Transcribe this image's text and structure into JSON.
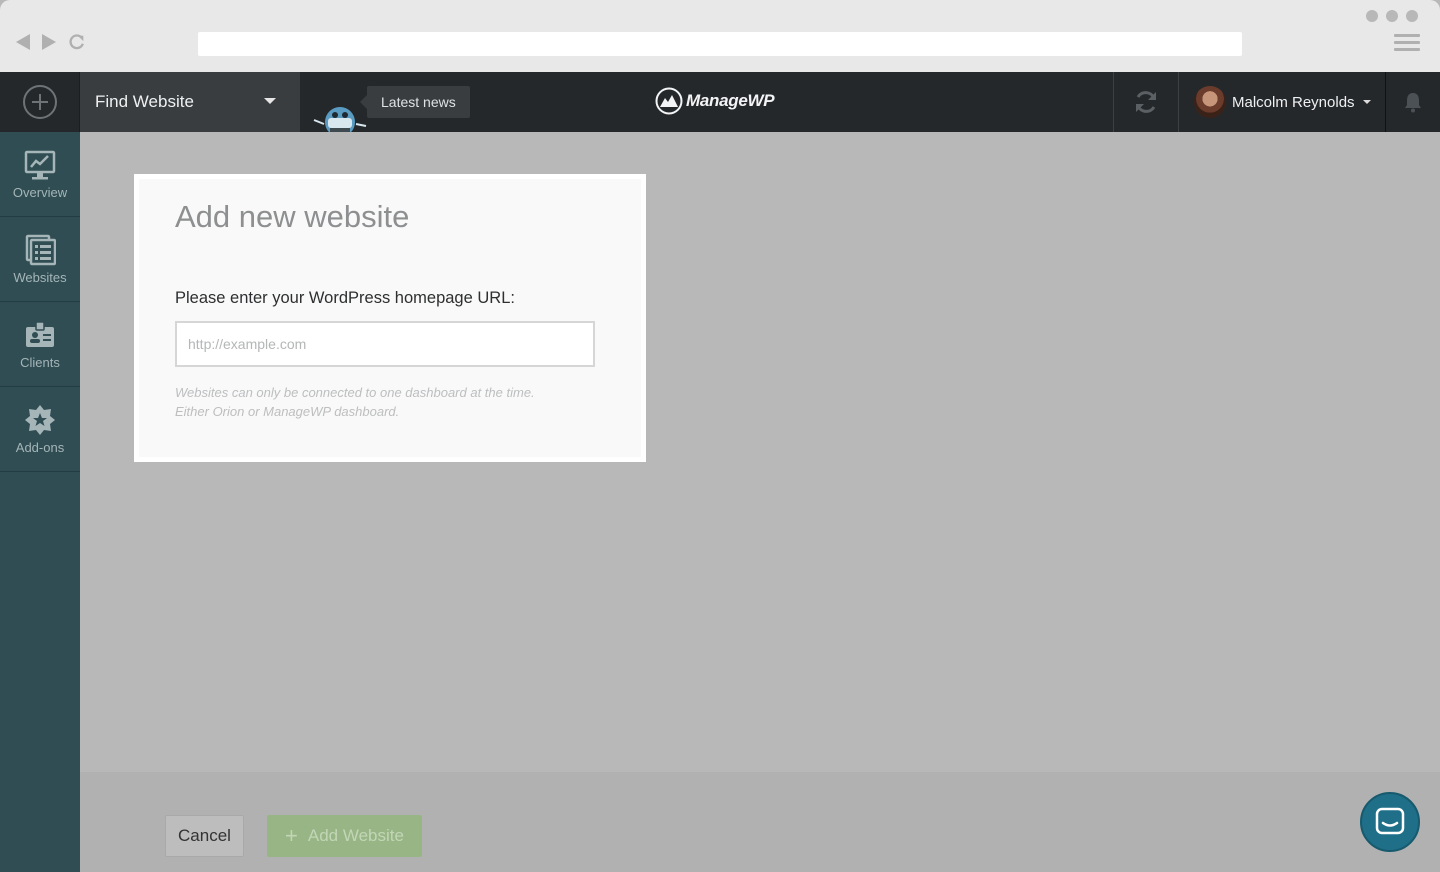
{
  "topbar": {
    "find_website_label": "Find Website",
    "latest_news_label": "Latest news",
    "logo_text": "ManageWP",
    "user_name": "Malcolm Reynolds"
  },
  "sidebar": {
    "items": [
      {
        "label": "Overview",
        "icon": "chart-monitor-icon"
      },
      {
        "label": "Websites",
        "icon": "websites-list-icon"
      },
      {
        "label": "Clients",
        "icon": "client-badge-icon"
      },
      {
        "label": "Add-ons",
        "icon": "addons-star-icon"
      }
    ]
  },
  "modal": {
    "title": "Add new website",
    "url_label": "Please enter your WordPress homepage URL:",
    "url_value": "",
    "url_placeholder": "http://example.com",
    "note_line1": "Websites can only be connected to one dashboard at the time.",
    "note_line2": "Either Orion or ManageWP dashboard."
  },
  "footer": {
    "cancel_label": "Cancel",
    "add_label": "Add Website",
    "add_icon": "plus-icon"
  },
  "colors": {
    "topbar_bg": "#25282b",
    "sidebar_bg": "#2f4d53",
    "overlay_bg": "#b8b8b8",
    "add_button_bg": "#98b585",
    "chat_bg": "#1f6f88"
  }
}
